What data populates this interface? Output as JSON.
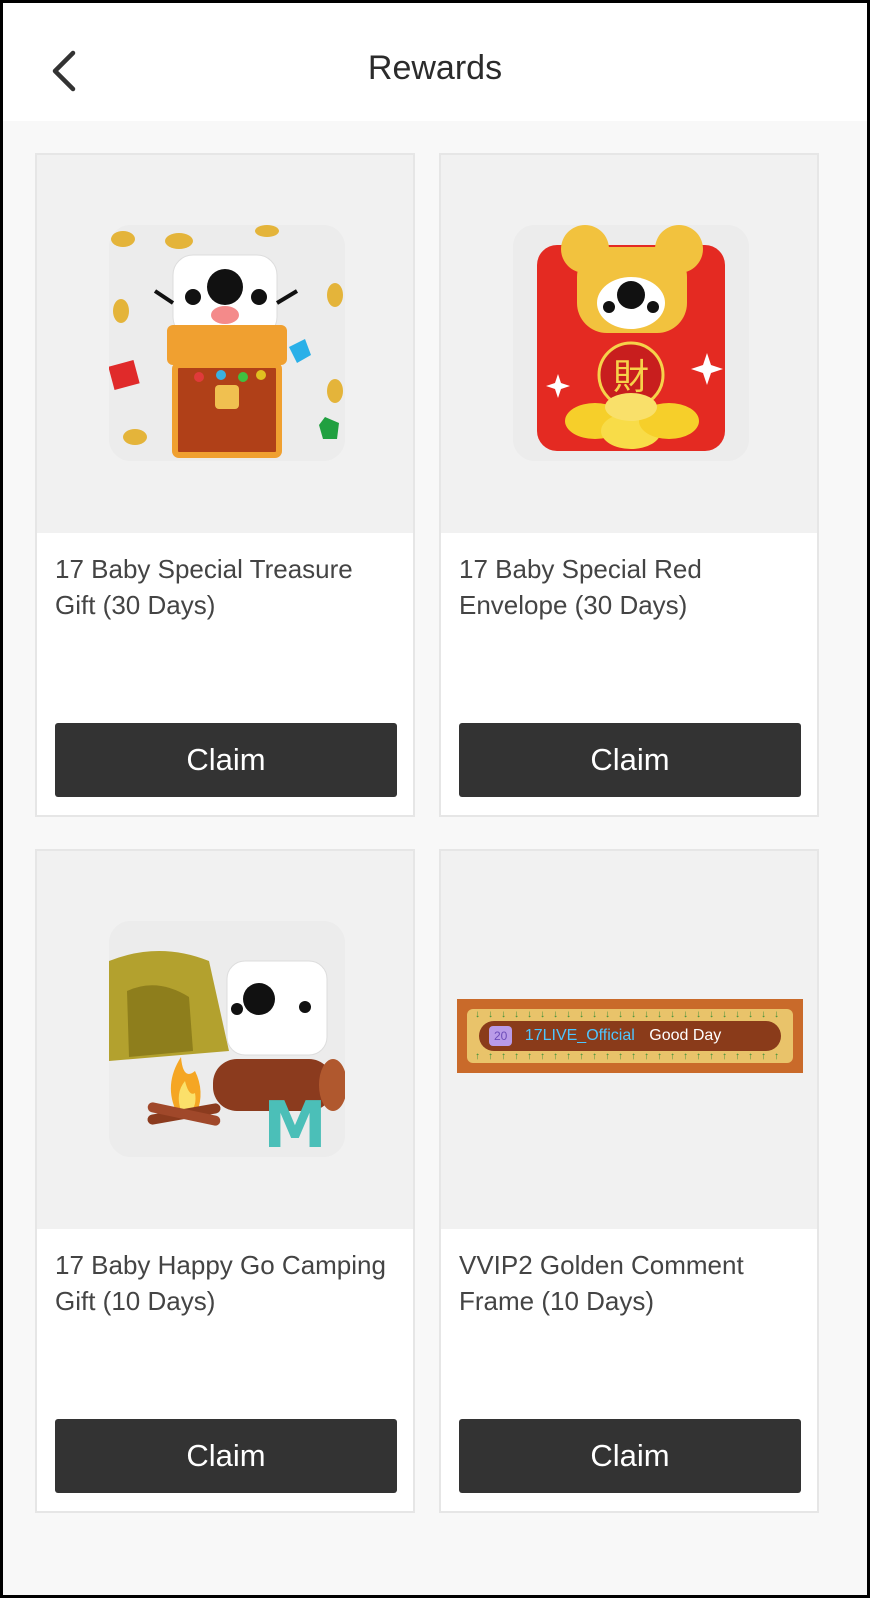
{
  "header": {
    "title": "Rewards",
    "back_icon": "chevron-left-icon"
  },
  "rewards": [
    {
      "name": "17 Baby Special Treasure Gift (30 Days)",
      "claim_label": "Claim",
      "icon": "treasure-chest-icon"
    },
    {
      "name": "17 Baby Special Red Envelope (30 Days)",
      "claim_label": "Claim",
      "icon": "red-envelope-icon"
    },
    {
      "name": "17 Baby Happy Go Camping Gift (10 Days)",
      "claim_label": "Claim",
      "icon": "camping-tent-icon"
    },
    {
      "name": "VVIP2 Golden Comment Frame (10 Days)",
      "claim_label": "Claim",
      "icon": "golden-comment-frame-icon",
      "preview": {
        "badge": "20",
        "username": "17LIVE_Official",
        "message": "Good Day"
      }
    }
  ],
  "colors": {
    "button": "#333333",
    "card_image_bg": "#f1f1f1",
    "page_bg": "#f8f8f8"
  }
}
